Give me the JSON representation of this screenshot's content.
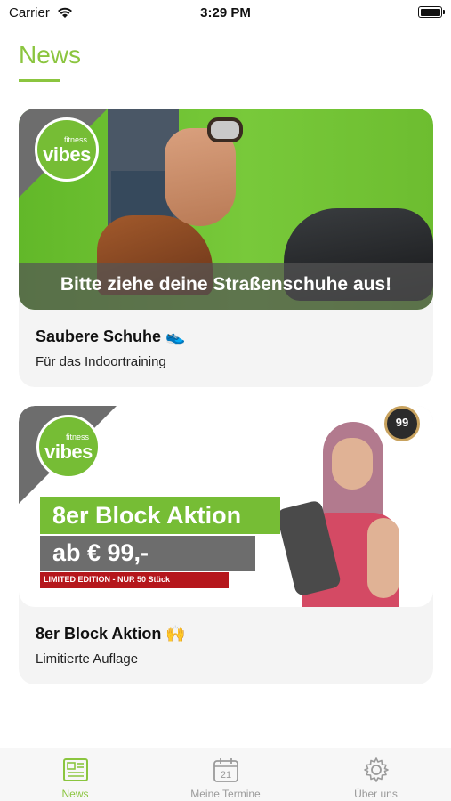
{
  "status_bar": {
    "carrier": "Carrier",
    "time": "3:29 PM"
  },
  "page": {
    "title": "News"
  },
  "cards": [
    {
      "banner_caption": "Bitte ziehe deine Straßenschuhe aus!",
      "logo_small": "fitness",
      "logo_main": "vibes",
      "title": "Saubere Schuhe 👟",
      "subtitle": "Für das Indoortraining"
    },
    {
      "logo_small": "fitness",
      "logo_main": "vibes",
      "headline": "8er Block Aktion",
      "price": "ab € 99,-",
      "limited": "LIMITED EDITION - NUR 50 Stück",
      "seal_number": "99",
      "title": "8er Block Aktion 🙌",
      "subtitle": "Limitierte Auflage"
    }
  ],
  "tabbar": {
    "items": [
      {
        "label": "News",
        "icon": "news-icon",
        "active": true
      },
      {
        "label": "Meine Termine",
        "icon": "calendar-icon",
        "active": false
      },
      {
        "label": "Über uns",
        "icon": "gear-icon",
        "active": false
      }
    ]
  },
  "colors": {
    "accent": "#8bc53f",
    "grey": "#6d6d6d",
    "red": "#b5171c"
  }
}
